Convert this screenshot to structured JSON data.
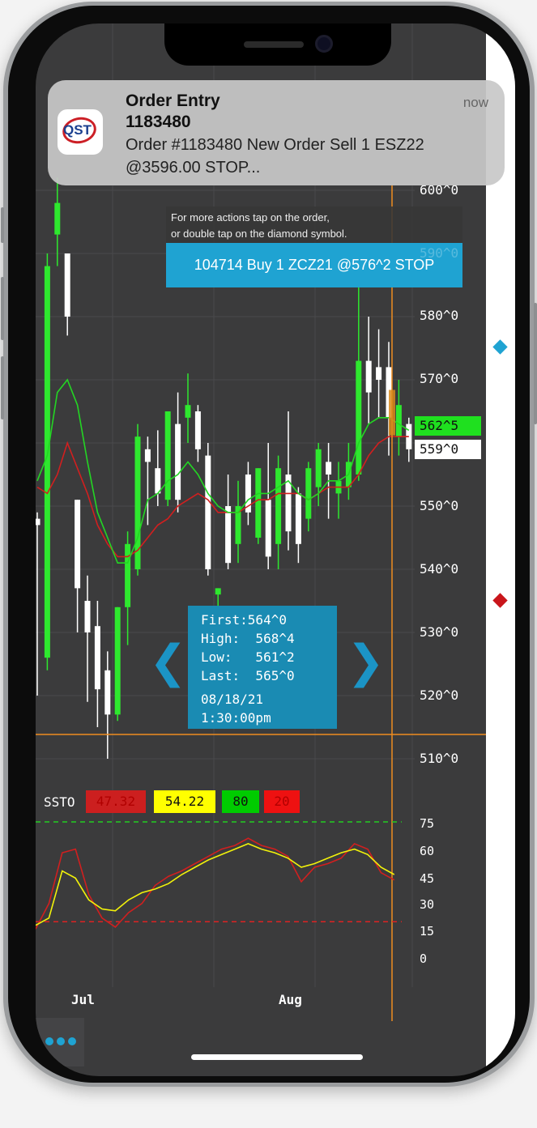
{
  "notification": {
    "app": "QST",
    "title": "Order Entry",
    "subtitle": "1183480",
    "body": "Order #1183480 New Order Sell 1 ESZ22 @3596.00 STOP...",
    "time": "now"
  },
  "hint": {
    "line1": "For more actions tap on the order,",
    "line2": "or double tap on the diamond symbol."
  },
  "order_banner": "104714 Buy 1 ZCZ21 @576^2 STOP",
  "price_axis": [
    "600^0",
    "590^0",
    "580^0",
    "570^0",
    "550^0",
    "540^0",
    "530^0",
    "520^0",
    "510^0"
  ],
  "price_tags": {
    "green": "562^5",
    "white": "559^0"
  },
  "ohlc": {
    "first": "First:564^0",
    "high": "High:  568^4",
    "low": "Low:   561^2",
    "last": "Last:  565^0",
    "date": "08/18/21",
    "time": "1:30:00pm"
  },
  "nav": {
    "prev": "❮",
    "next": "❯"
  },
  "ssto": {
    "label": "SSTO",
    "values": [
      {
        "text": "47.32",
        "bg": "#cc1f1f",
        "fg": "#b10000"
      },
      {
        "text": "54.22",
        "bg": "#ffff00",
        "fg": "#111111"
      },
      {
        "text": "80",
        "bg": "#00cc00",
        "fg": "#111111"
      },
      {
        "text": "20",
        "bg": "#ee1111",
        "fg": "#b10000"
      }
    ]
  },
  "indicator_axis": [
    "75",
    "60",
    "45",
    "30",
    "15",
    "0"
  ],
  "date_axis": [
    "Jul",
    "Aug"
  ],
  "colors": {
    "background": "#3b3b3c",
    "up_candle": "#2ee82e",
    "down_candle": "#ffffff",
    "accent": "#1fa3d2",
    "crosshair": "#f08c1e",
    "fast_ma": "#23d623",
    "slow_ma": "#d11f1f"
  },
  "chart_data": {
    "type": "candlestick",
    "x_ticks": [
      "Jul",
      "Aug"
    ],
    "ylim": [
      505,
      610
    ],
    "candles": [
      {
        "o": 548,
        "h": 549,
        "l": 520,
        "c": 547
      },
      {
        "o": 526,
        "h": 590,
        "l": 524,
        "c": 588
      },
      {
        "o": 593,
        "h": 602,
        "l": 588,
        "c": 598
      },
      {
        "o": 590,
        "h": 590,
        "l": 577,
        "c": 580
      },
      {
        "o": 551,
        "h": 551,
        "l": 530,
        "c": 537
      },
      {
        "o": 535,
        "h": 539,
        "l": 519,
        "c": 530
      },
      {
        "o": 531,
        "h": 535,
        "l": 515,
        "c": 521
      },
      {
        "o": 524,
        "h": 527,
        "l": 510,
        "c": 517
      },
      {
        "o": 517,
        "h": 534,
        "l": 516,
        "c": 534
      },
      {
        "o": 534,
        "h": 546,
        "l": 528,
        "c": 544
      },
      {
        "o": 540,
        "h": 563,
        "l": 539,
        "c": 561
      },
      {
        "o": 559,
        "h": 561,
        "l": 547,
        "c": 557
      },
      {
        "o": 556,
        "h": 562,
        "l": 550,
        "c": 552
      },
      {
        "o": 551,
        "h": 565,
        "l": 550,
        "c": 565
      },
      {
        "o": 563,
        "h": 568,
        "l": 549,
        "c": 551
      },
      {
        "o": 564,
        "h": 571,
        "l": 560,
        "c": 566
      },
      {
        "o": 565,
        "h": 566,
        "l": 557,
        "c": 559
      },
      {
        "o": 558,
        "h": 560,
        "l": 539,
        "c": 540
      },
      {
        "o": 536,
        "h": 537,
        "l": 523,
        "c": 537
      },
      {
        "o": 550,
        "h": 555,
        "l": 540,
        "c": 541
      },
      {
        "o": 544,
        "h": 554,
        "l": 541,
        "c": 550
      },
      {
        "o": 555,
        "h": 557,
        "l": 547,
        "c": 549
      },
      {
        "o": 545,
        "h": 556,
        "l": 544,
        "c": 556
      },
      {
        "o": 551,
        "h": 560,
        "l": 540,
        "c": 542
      },
      {
        "o": 544,
        "h": 558,
        "l": 540,
        "c": 556
      },
      {
        "o": 555,
        "h": 565,
        "l": 543,
        "c": 546
      },
      {
        "o": 552,
        "h": 553,
        "l": 541,
        "c": 544
      },
      {
        "o": 548,
        "h": 557,
        "l": 546,
        "c": 556
      },
      {
        "o": 553,
        "h": 560,
        "l": 550,
        "c": 559
      },
      {
        "o": 557,
        "h": 560,
        "l": 548,
        "c": 555
      },
      {
        "o": 552,
        "h": 557,
        "l": 548,
        "c": 554
      },
      {
        "o": 553,
        "h": 560,
        "l": 551,
        "c": 557
      },
      {
        "o": 555,
        "h": 585,
        "l": 554,
        "c": 573
      },
      {
        "o": 573,
        "h": 580,
        "l": 563,
        "c": 568
      },
      {
        "o": 572,
        "h": 578,
        "l": 564,
        "c": 570
      },
      {
        "o": 572,
        "h": 576,
        "l": 558,
        "c": 564
      },
      {
        "o": 561,
        "h": 570,
        "l": 558,
        "c": 566
      },
      {
        "o": 563,
        "h": 564,
        "l": 557,
        "c": 559
      }
    ],
    "fast_ma": [
      554,
      558,
      568,
      570,
      566,
      557,
      549,
      545,
      541,
      541,
      545,
      551,
      552,
      554,
      555,
      557,
      555,
      552,
      550,
      549,
      549,
      551,
      552,
      552,
      553,
      554,
      552,
      551,
      552,
      554,
      554,
      555,
      560,
      563,
      564,
      564,
      563,
      562
    ],
    "slow_ma": [
      553,
      552,
      555,
      560,
      556,
      552,
      547,
      544,
      542,
      542,
      543,
      545,
      547,
      548,
      550,
      551,
      552,
      551,
      549,
      549,
      549,
      550,
      551,
      551,
      552,
      552,
      552,
      551,
      552,
      553,
      553,
      553,
      555,
      558,
      560,
      561,
      561,
      561
    ],
    "oscillator_range": [
      0,
      85
    ],
    "overbought": 75,
    "oversold": 20,
    "ssto_k": [
      16,
      30,
      58,
      60,
      35,
      22,
      17,
      25,
      30,
      40,
      45,
      48,
      52,
      56,
      60,
      62,
      66,
      62,
      60,
      56,
      42,
      50,
      52,
      55,
      63,
      60,
      47,
      43
    ],
    "ssto_d": [
      18,
      22,
      48,
      44,
      32,
      27,
      26,
      32,
      36,
      38,
      41,
      46,
      50,
      54,
      57,
      60,
      63,
      60,
      58,
      55,
      50,
      52,
      55,
      58,
      60,
      57,
      50,
      46
    ]
  }
}
